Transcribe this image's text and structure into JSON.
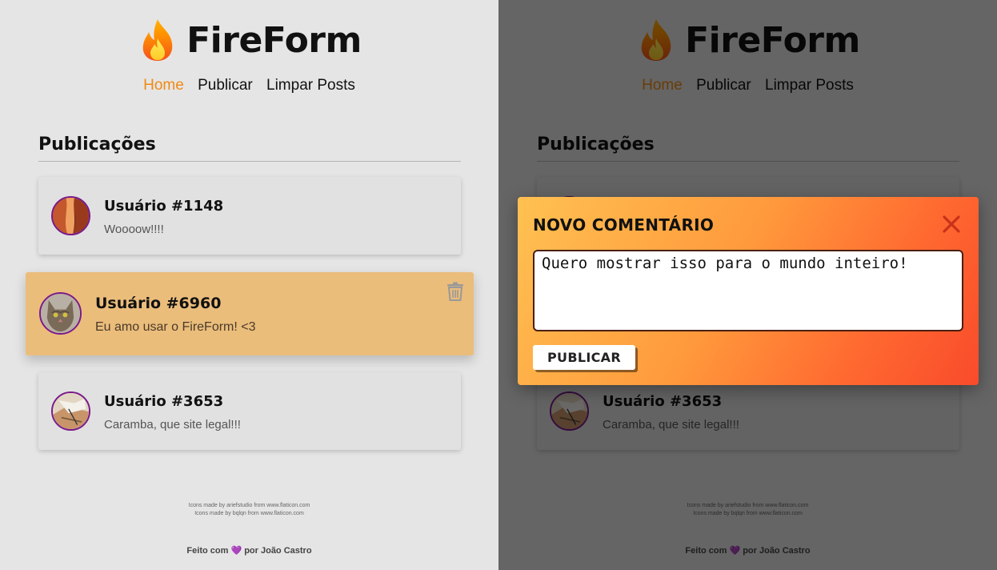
{
  "app": {
    "title": "FireForm",
    "nav": [
      "Home",
      "Publicar",
      "Limpar Posts"
    ],
    "active_nav": "Home",
    "section_title": "Publicações"
  },
  "posts": [
    {
      "user": "Usuário #1148",
      "message": "Woooow!!!!",
      "avatar": "canyon-avatar",
      "highlighted": false
    },
    {
      "user": "Usuário #6960",
      "message": "Eu amo usar o FireForm! <3",
      "avatar": "cat-avatar",
      "highlighted": true
    },
    {
      "user": "Usuário #3653",
      "message": "Caramba, que site legal!!!",
      "avatar": "map-avatar",
      "highlighted": false
    }
  ],
  "credits": [
    "Icons made by ariefstudio from www.flaticon.com",
    "Icons made by bqlqn from www.flaticon.com"
  ],
  "footer": {
    "prefix": "Feito com",
    "heart": "💜",
    "suffix": "por João Castro"
  },
  "modal": {
    "title": "NOVO COMENTÁRIO",
    "textarea_value": "Quero mostrar isso para o mundo inteiro!",
    "button_label": "PUBLICAR"
  },
  "colors": {
    "accent": "#f08a14",
    "card_highlight": "#ebbd7b",
    "avatar_border": "#7a1a8c",
    "modal_gradient_start": "#ffc152",
    "modal_gradient_end": "#f94b2b"
  },
  "icons": {
    "brand": "flame-icon",
    "delete": "trash-icon",
    "close": "close-icon"
  }
}
